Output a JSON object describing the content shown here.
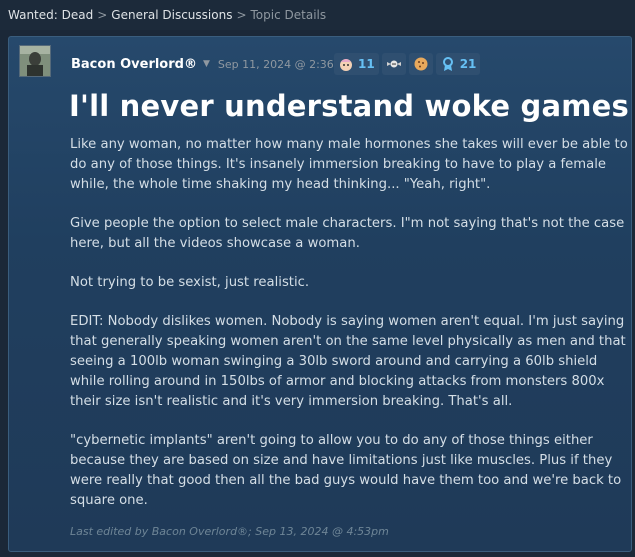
{
  "breadcrumb": {
    "game": "Wanted: Dead",
    "forum": "General Discussions",
    "current": "Topic Details",
    "separator": ">"
  },
  "post": {
    "author": "Bacon Overlord®",
    "timestamp": "Sep 11, 2024 @ 2:36pm",
    "awards": [
      {
        "icon": "baby-face-icon",
        "count": "11"
      },
      {
        "icon": "winged-skull-icon",
        "count": ""
      },
      {
        "icon": "cookie-icon",
        "count": ""
      },
      {
        "icon": "ribbon-medal-icon",
        "count": "21"
      }
    ],
    "title": "I'll never understand woke games",
    "paragraphs": [
      "Like any woman, no matter how many male hormones she takes will ever be able to do any of those things. It's insanely immersion breaking to have to play a female while, the whole time shaking my head thinking... \"Yeah, right\".",
      "Give people the option to select male characters. I\"m not saying that's not the case here, but all the videos showcase a woman.",
      "Not trying to be sexist, just realistic.",
      "EDIT: Nobody dislikes women. Nobody is saying women aren't equal. I'm just saying that generally speaking women aren't on the same level physically as men and that seeing a 100lb woman swinging a 30lb sword around and carrying a 60lb shield while rolling around in 150lbs of armor and blocking attacks from monsters 800x their size isn't realistic and it's very immersion breaking. That's all.",
      "\"cybernetic implants\" aren't going to allow you to do any of those things either because they are based on size and have limitations just like muscles. Plus if they were really that good then all the bad guys would have them too and we're back to square one."
    ],
    "edited": "Last edited by Bacon Overlord®; Sep 13, 2024 @ 4:53pm"
  },
  "colors": {
    "background": "#1b2838",
    "post_bg": "#26496c",
    "accent": "#66c0f4",
    "text": "#c6d4df"
  }
}
